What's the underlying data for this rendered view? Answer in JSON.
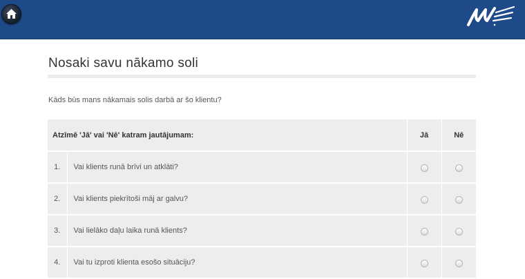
{
  "header": {
    "home_icon": "home-icon",
    "logo_icon": "brand-logo"
  },
  "page": {
    "title": "Nosaki savu nākamo soli",
    "question": "Kāds būs mans nākamais solis darbā ar šo klientu?"
  },
  "table": {
    "header_label": "Atzīmē 'Jā' vai 'Nē' katram jautājumam:",
    "col_yes": "Jā",
    "col_no": "Nē",
    "rows": [
      {
        "num": "1.",
        "text": "Vai klients runā brīvi un atklāti?"
      },
      {
        "num": "2.",
        "text": "Vai klients piekrītoši māj ar galvu?"
      },
      {
        "num": "3.",
        "text": "Vai lielāko daļu laika runā klients?"
      },
      {
        "num": "4.",
        "text": "Vai tu izproti klienta esošo situāciju?"
      }
    ]
  },
  "colors": {
    "header_bg": "#1f4a8a",
    "row_bg": "#ededed"
  }
}
